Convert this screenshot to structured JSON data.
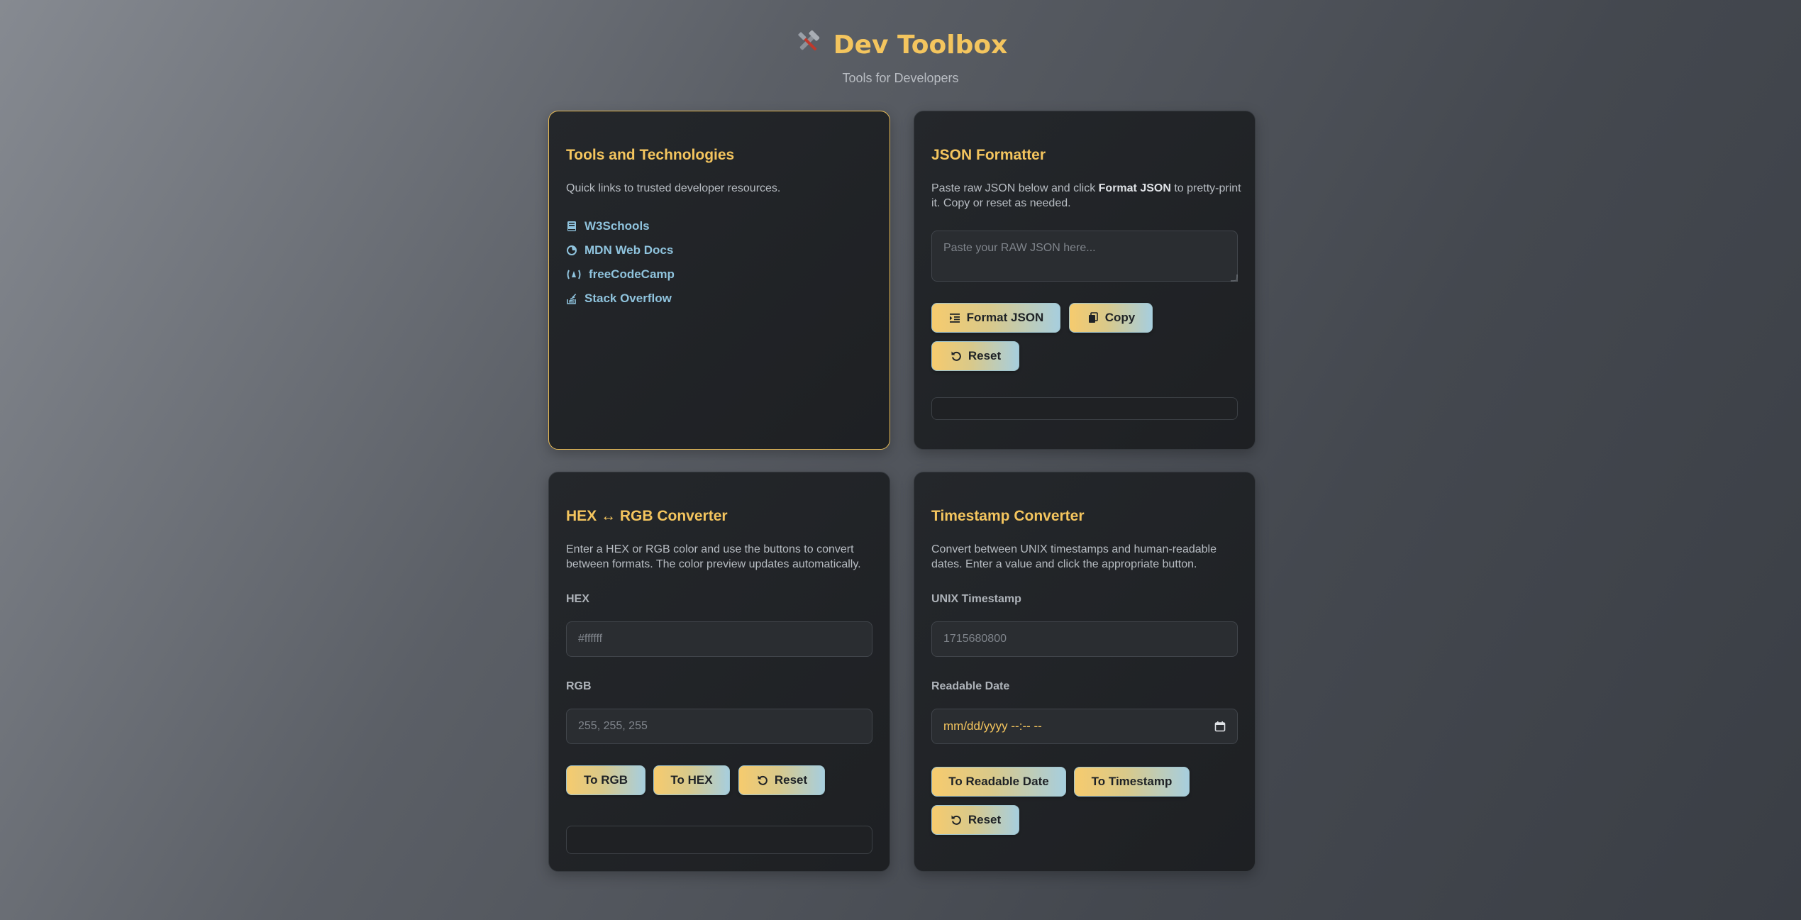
{
  "header": {
    "icon": "tools-icon",
    "title": "Dev Toolbox",
    "subtitle": "Tools for Developers"
  },
  "colors": {
    "accent": "#f4c55e",
    "link": "#8fc3dd",
    "card_bg": "#1f2124",
    "button_gradient_start": "#f6cb6e",
    "button_gradient_end": "#a7cede"
  },
  "tools_card": {
    "title": "Tools and Technologies",
    "description": "Quick links to trusted developer resources.",
    "links": [
      {
        "label": "W3Schools",
        "icon": "book-icon"
      },
      {
        "label": "MDN Web Docs",
        "icon": "firefox-icon"
      },
      {
        "label": "freeCodeCamp",
        "icon": "freecodecamp-icon"
      },
      {
        "label": "Stack Overflow",
        "icon": "stack-overflow-icon"
      }
    ]
  },
  "json_card": {
    "title": "JSON Formatter",
    "description_prefix": "Paste raw JSON below and click ",
    "description_bold": "Format JSON",
    "description_suffix": " to pretty-print it. Copy or reset as needed.",
    "placeholder": "Paste your RAW JSON here...",
    "format_button": "Format JSON",
    "copy_button": "Copy",
    "reset_button": "Reset",
    "output": ""
  },
  "hex_card": {
    "title": "HEX ↔ RGB Converter",
    "description": "Enter a HEX or RGB color and use the buttons to convert between formats. The color preview updates automatically.",
    "hex_label": "HEX",
    "hex_placeholder": "#ffffff",
    "rgb_label": "RGB",
    "rgb_placeholder": "255, 255, 255",
    "to_rgb_button": "To RGB",
    "to_hex_button": "To HEX",
    "reset_button": "Reset",
    "output": ""
  },
  "timestamp_card": {
    "title": "Timestamp Converter",
    "description": "Convert between UNIX timestamps and human-readable dates. Enter a value and click the appropriate button.",
    "unix_label": "UNIX Timestamp",
    "unix_placeholder": "1715680800",
    "date_label": "Readable Date",
    "date_value": "mm/dd/yyyy --:-- --",
    "to_date_button": "To Readable Date",
    "to_timestamp_button": "To Timestamp",
    "reset_button": "Reset"
  }
}
